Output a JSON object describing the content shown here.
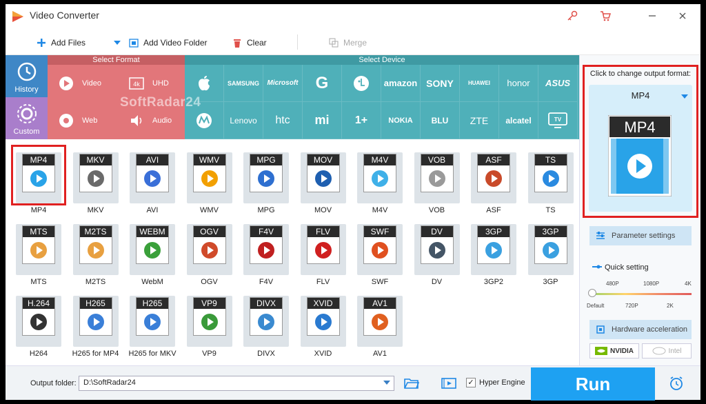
{
  "window": {
    "title": "Video Converter"
  },
  "toolbar": {
    "add_files": "Add Files",
    "add_video_folder": "Add Video Folder",
    "clear": "Clear",
    "merge": "Merge"
  },
  "nav": {
    "history": "History",
    "custom": "Custom"
  },
  "format_panel": {
    "title": "Select Format",
    "video": "Video",
    "uhd": "UHD",
    "web": "Web",
    "audio": "Audio"
  },
  "device_panel": {
    "title": "Select Device",
    "row1": [
      "apple",
      "SAMSUNG",
      "Microsoft",
      "G",
      "LG",
      "amazon",
      "SONY",
      "HUAWEI",
      "honor",
      "ASUS"
    ],
    "row2": [
      "motorola",
      "Lenovo",
      "htc",
      "mi",
      "1+",
      "NOKIA",
      "BLU",
      "ZTE",
      "alcatel",
      "TV"
    ]
  },
  "watermark": "SoftRadar24",
  "formats": [
    {
      "name": "MP4",
      "label": "MP4"
    },
    {
      "name": "MKV",
      "label": "MKV"
    },
    {
      "name": "AVI",
      "label": "AVI"
    },
    {
      "name": "WMV",
      "label": "WMV"
    },
    {
      "name": "MPG",
      "label": "MPG"
    },
    {
      "name": "MOV",
      "label": "MOV"
    },
    {
      "name": "M4V",
      "label": "M4V"
    },
    {
      "name": "VOB",
      "label": "VOB"
    },
    {
      "name": "ASF",
      "label": "ASF"
    },
    {
      "name": "TS",
      "label": "TS"
    },
    {
      "name": "MTS",
      "label": "MTS"
    },
    {
      "name": "M2TS",
      "label": "M2TS"
    },
    {
      "name": "WEBM",
      "label": "WebM"
    },
    {
      "name": "OGV",
      "label": "OGV"
    },
    {
      "name": "F4V",
      "label": "F4V"
    },
    {
      "name": "FLV",
      "label": "FLV"
    },
    {
      "name": "SWF",
      "label": "SWF"
    },
    {
      "name": "DV",
      "label": "DV"
    },
    {
      "name": "3GP",
      "label": "3GP2"
    },
    {
      "name": "3GP",
      "label": "3GP"
    },
    {
      "name": "H.264",
      "label": "H264"
    },
    {
      "name": "H265",
      "label": "H265 for MP4"
    },
    {
      "name": "H265",
      "label": "H265 for MKV"
    },
    {
      "name": "VP9",
      "label": "VP9"
    },
    {
      "name": "DIVX",
      "label": "DIVX"
    },
    {
      "name": "XVID",
      "label": "XVID"
    },
    {
      "name": "AV1",
      "label": "AV1"
    }
  ],
  "output": {
    "hint": "Click to change output format:",
    "format": "MP4",
    "card_label": "MP4"
  },
  "settings": {
    "parameter": "Parameter settings",
    "quick": "Quick setting",
    "ticks_top": [
      "480P",
      "1080P",
      "4K"
    ],
    "ticks_bottom": [
      "Default",
      "720P",
      "2K"
    ],
    "hardware": "Hardware acceleration",
    "nvidia": "NVIDIA",
    "intel": "Intel"
  },
  "bottom": {
    "output_folder_label": "Output folder:",
    "output_folder_value": "D:\\SoftRadar24",
    "hyper_engine": "Hyper Engine",
    "run": "Run"
  },
  "colors": {
    "accent": "#1ea1f2",
    "format_panel": "#e2767a",
    "device_panel": "#4fb0b9",
    "selection": "#e02020"
  }
}
